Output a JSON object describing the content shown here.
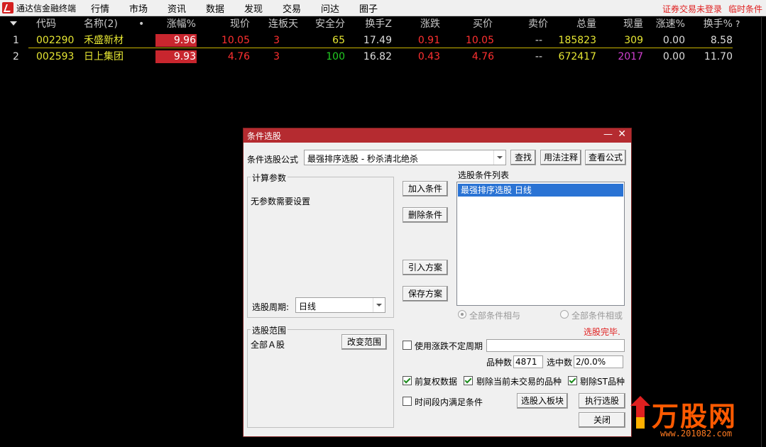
{
  "menubar": {
    "app_title": "通达信金融终端",
    "items": [
      "行情",
      "市场",
      "资讯",
      "数据",
      "发现",
      "交易",
      "问达",
      "圈子"
    ],
    "status_login": "证券交易未登录",
    "status_temp": "临时条件"
  },
  "table": {
    "headers": {
      "code": "代码",
      "name": "名称(2)",
      "dot": "•",
      "change_pct": "涨幅%",
      "price": "现价",
      "limit_days": "连板天",
      "safety": "安全分",
      "turnover_z": "换手Z",
      "change": "涨跌",
      "bid": "买价",
      "ask": "卖价",
      "volume": "总量",
      "cur_vol": "现量",
      "speed": "涨速%",
      "turnover_pct": "换手%",
      "help": "?"
    },
    "rows": [
      {
        "idx": "1",
        "code": "002290",
        "name": "禾盛新材",
        "change_pct": "9.96",
        "price": "10.05",
        "limit_days": "3",
        "safety": "65",
        "turnover_z": "17.49",
        "change": "0.91",
        "bid": "10.05",
        "ask": "--",
        "volume": "185823",
        "cur_vol": "309",
        "speed": "0.00",
        "turnover_pct": "8.58"
      },
      {
        "idx": "2",
        "code": "002593",
        "name": "日上集团",
        "change_pct": "9.93",
        "price": "4.76",
        "limit_days": "3",
        "safety": "100",
        "turnover_z": "16.82",
        "change": "0.43",
        "bid": "4.76",
        "ask": "--",
        "volume": "672417",
        "cur_vol": "2017",
        "speed": "0.00",
        "turnover_pct": "11.70"
      }
    ]
  },
  "dialog": {
    "title": "条件选股",
    "formula_label": "条件选股公式",
    "formula_value": "最强排序选股 - 秒杀清北绝杀",
    "btn_find": "查找",
    "btn_usage": "用法注释",
    "btn_view": "查看公式",
    "params_group": "计算参数",
    "params_text": "无参数需要设置",
    "period_label": "选股周期:",
    "period_value": "日线",
    "btn_add": "加入条件",
    "btn_delete": "删除条件",
    "btn_import": "引入方案",
    "btn_save": "保存方案",
    "cond_list_label": "选股条件列表",
    "cond_items": [
      "最强排序选股  日线"
    ],
    "radio_and": "全部条件相与",
    "radio_or": "全部条件相或",
    "status": "选股完毕.",
    "scope_group": "选股范围",
    "scope_value": "全部Ａ股",
    "btn_change_scope": "改变范围",
    "chk_volatile": "使用涨跌不定周期",
    "count_label": "品种数",
    "count_value": "4871",
    "selected_label": "选中数",
    "selected_value": "2/0.0%",
    "chk_adjust": "前复权数据",
    "chk_exclude_untraded": "剔除当前未交易的品种",
    "chk_exclude_st": "剔除ST品种",
    "chk_timerange": "时间段内满足条件",
    "btn_to_block": "选股入板块",
    "btn_execute": "执行选股",
    "btn_close": "关闭"
  },
  "watermark": {
    "name": "万股网",
    "url": "www.201082.com"
  },
  "colors": {
    "up": "#ff3030",
    "code": "#e6e633",
    "safety": "#22cc22",
    "cur_vol_purple": "#d040d0",
    "dialog_title": "#b52b30",
    "list_select": "#2a73d4"
  }
}
